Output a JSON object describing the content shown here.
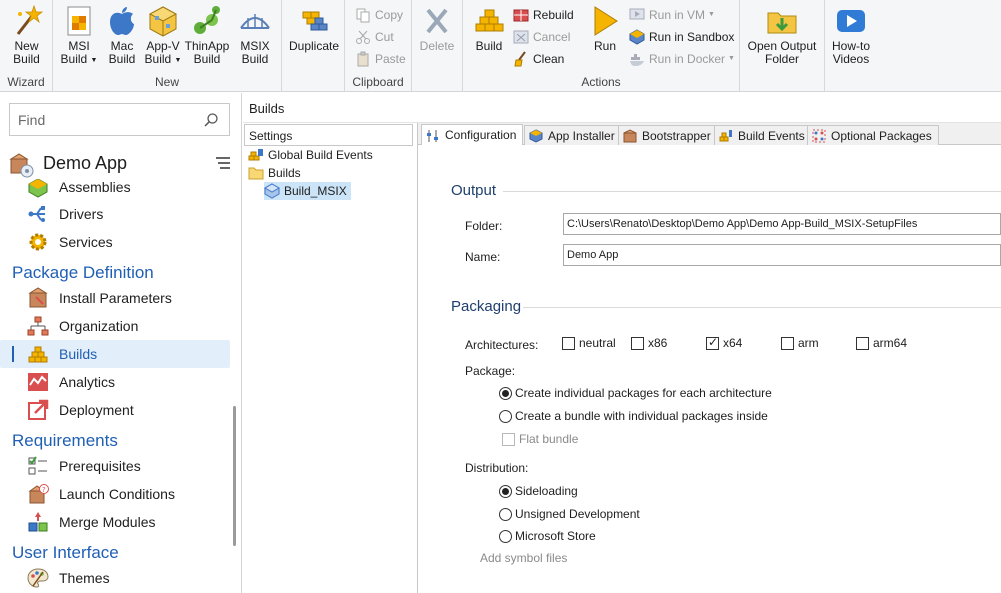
{
  "ribbon": {
    "groups": {
      "wizard": "Wizard",
      "new": "New",
      "clipboard": "Clipboard",
      "actions": "Actions"
    },
    "new_build": "New\nBuild",
    "msi_build": [
      "MSI",
      "Build"
    ],
    "mac_build": [
      "Mac",
      "Build"
    ],
    "appv_build": [
      "App-V",
      "Build"
    ],
    "thinapp_build": [
      "ThinApp",
      "Build"
    ],
    "msix_build": [
      "MSIX",
      "Build"
    ],
    "new_build_lines": [
      "New",
      "Build"
    ],
    "duplicate": "Duplicate",
    "copy": "Copy",
    "cut": "Cut",
    "paste": "Paste",
    "delete": "Delete",
    "build": "Build",
    "rebuild": "Rebuild",
    "cancel": "Cancel",
    "clean": "Clean",
    "run": "Run",
    "run_in_vm": "Run in VM",
    "run_in_sandbox": "Run in Sandbox",
    "run_in_docker": "Run in Docker",
    "open_output_folder": [
      "Open Output",
      "Folder"
    ],
    "howto_videos": [
      "How-to",
      "Videos"
    ]
  },
  "left_panel": {
    "search_placeholder": "Find",
    "project_title": "Demo App",
    "items_top": [
      {
        "label": "Assemblies",
        "icon": "assemblies-icon"
      },
      {
        "label": "Drivers",
        "icon": "drivers-icon"
      },
      {
        "label": "Services",
        "icon": "services-icon"
      }
    ],
    "sections": {
      "package_definition": "Package Definition",
      "requirements": "Requirements",
      "user_interface": "User Interface"
    },
    "package_definition_items": [
      {
        "label": "Install Parameters",
        "icon": "install-parameters-icon"
      },
      {
        "label": "Organization",
        "icon": "organization-icon"
      },
      {
        "label": "Builds",
        "icon": "builds-icon"
      },
      {
        "label": "Analytics",
        "icon": "analytics-icon"
      },
      {
        "label": "Deployment",
        "icon": "deployment-icon"
      }
    ],
    "requirements_items": [
      {
        "label": "Prerequisites",
        "icon": "prerequisites-icon"
      },
      {
        "label": "Launch Conditions",
        "icon": "launch-conditions-icon"
      },
      {
        "label": "Merge Modules",
        "icon": "merge-modules-icon"
      }
    ],
    "user_interface_items": [
      {
        "label": "Themes",
        "icon": "themes-icon"
      }
    ]
  },
  "header": {
    "title": "Builds"
  },
  "tree": {
    "header": "Settings",
    "items": [
      "Global Build Events",
      "Builds",
      "Build_MSIX"
    ]
  },
  "tabs": [
    {
      "label": "Configuration",
      "active": true
    },
    {
      "label": "App Installer",
      "active": false
    },
    {
      "label": "Bootstrapper",
      "active": false
    },
    {
      "label": "Build Events",
      "active": false
    },
    {
      "label": "Optional Packages",
      "active": false
    }
  ],
  "config": {
    "output_title": "Output",
    "folder_label": "Folder:",
    "folder_value": "C:\\Users\\Renato\\Desktop\\Demo App\\Demo App-Build_MSIX-SetupFiles",
    "name_label": "Name:",
    "name_value": "Demo App",
    "packaging_title": "Packaging",
    "architectures_label": "Architectures:",
    "architectures": [
      {
        "label": "neutral",
        "checked": false
      },
      {
        "label": "x86",
        "checked": false
      },
      {
        "label": "x64",
        "checked": true
      },
      {
        "label": "arm",
        "checked": false
      },
      {
        "label": "arm64",
        "checked": false
      }
    ],
    "package_label": "Package:",
    "package_options": [
      {
        "label": "Create individual packages for each architecture",
        "selected": true
      },
      {
        "label": "Create a bundle with individual packages inside",
        "selected": false
      }
    ],
    "flat_bundle": "Flat bundle",
    "distribution_label": "Distribution:",
    "distribution_options": [
      {
        "label": "Sideloading",
        "selected": true
      },
      {
        "label": "Unsigned Development",
        "selected": false
      },
      {
        "label": "Microsoft Store",
        "selected": false
      }
    ],
    "add_symbol_files": "Add symbol files"
  },
  "colors": {
    "accent": "#1f5fb4",
    "selection": "#e3eefb",
    "tree_selection": "#cce4f7"
  }
}
